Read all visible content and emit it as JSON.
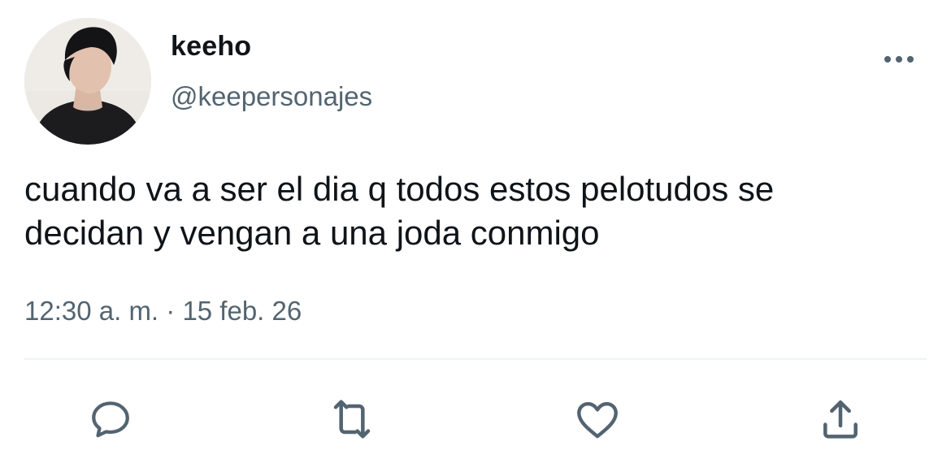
{
  "user": {
    "display_name": "keeho",
    "handle": "@keepersonajes",
    "avatar_icon": "profile-photo"
  },
  "tweet": {
    "text_line1": "cuando va a ser el dia q todos estos pelotudos se",
    "text_line2": "decidan y vengan a una joda conmigo",
    "time": "12:30 a. m.",
    "separator": " · ",
    "date": "15 feb. 26"
  },
  "actions": [
    {
      "name": "reply",
      "icon": "speech-bubble-icon"
    },
    {
      "name": "retweet",
      "icon": "retweet-arrows-icon"
    },
    {
      "name": "like",
      "icon": "heart-icon"
    },
    {
      "name": "share",
      "icon": "share-upload-icon"
    }
  ],
  "colors": {
    "text": "#0f1419",
    "secondary": "#536471",
    "divider": "#eff3f4",
    "icon": "#536471"
  }
}
